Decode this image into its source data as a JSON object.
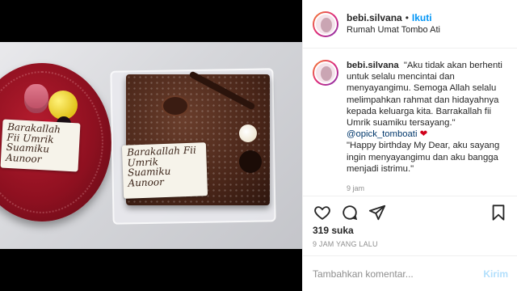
{
  "post": {
    "username": "bebi.silvana",
    "separator": "•",
    "follow_label": "Ikuti",
    "location": "Rumah Umat Tombo Ati",
    "caption": {
      "username": "bebi.silvana",
      "text_1": "\"Aku tidak akan berhenti untuk selalu mencintai dan menyayangimu. Semoga Allah selalu melimpahkan rahmat dan hidayahnya kepada keluarga kita. Barrakallah fii Umrik suamiku tersayang.\"",
      "mention": "@opick_tomboati",
      "heart": "❤",
      "text_2": "\"Happy birthday My Dear, aku sayang ingin menyayangimu dan aku bangga menjadi istrimu.\"",
      "time": "9 jam"
    },
    "likes": "319 suka",
    "timestamp": "9 JAM YANG LALU",
    "comment_placeholder": "Tambahkan komentar...",
    "post_button": "Kirim"
  },
  "photo": {
    "plaque_left": "Barakallah Fii Umrik Suamiku Aunoor",
    "plaque_right": "Barakallah Fii Umrik Suamiku Aunoor"
  },
  "icons": {
    "like": "heart-icon",
    "comment": "comment-icon",
    "share": "share-icon",
    "save": "bookmark-icon"
  },
  "colors": {
    "link_blue": "#0095f6",
    "mention": "#00376b",
    "muted": "#8e8e8e",
    "post_button_disabled": "#b2dffc"
  }
}
